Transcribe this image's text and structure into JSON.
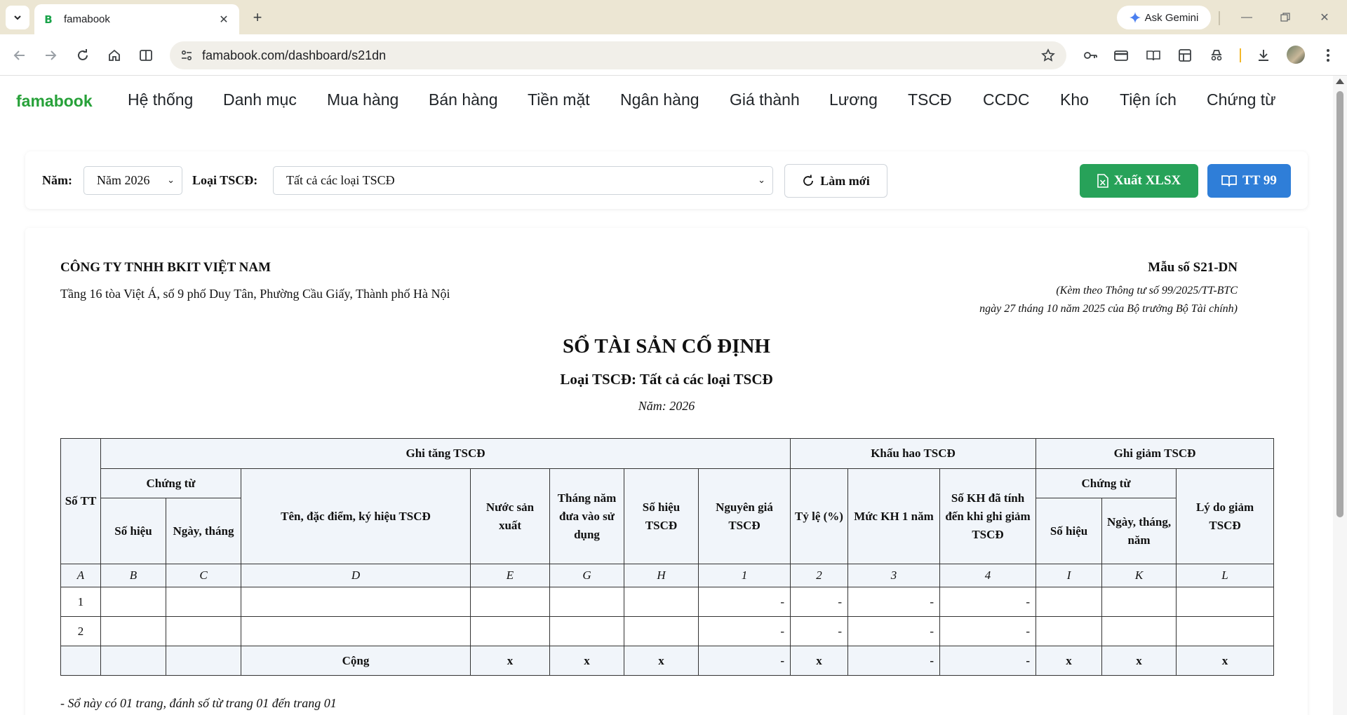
{
  "browser": {
    "tab_title": "famabook",
    "favicon_letter": "B",
    "url": "famabook.com/dashboard/s21dn",
    "gemini_label": "Ask Gemini"
  },
  "nav": {
    "brand": "famabook",
    "items": [
      "Hệ thống",
      "Danh mục",
      "Mua hàng",
      "Bán hàng",
      "Tiền mặt",
      "Ngân hàng",
      "Giá thành",
      "Lương",
      "TSCĐ",
      "CCDC",
      "Kho",
      "Tiện ích",
      "Chứng từ"
    ]
  },
  "filters": {
    "year_label": "Năm:",
    "year_value": "Năm 2026",
    "type_label": "Loại TSCĐ:",
    "type_value": "Tất cả các loại TSCĐ",
    "refresh_label": "Làm mới",
    "export_label": "Xuất XLSX",
    "tt_label": "TT 99"
  },
  "report": {
    "company": "CÔNG TY TNHH BKIT VIỆT NAM",
    "address": "Tầng 16 tòa Việt Á, số 9 phố Duy Tân, Phường Cầu Giấy, Thành phố Hà Nội",
    "form_no": "Mẫu số S21-DN",
    "form_note_1": "(Kèm theo Thông tư số 99/2025/TT-BTC",
    "form_note_2": "ngày 27 tháng 10 năm 2025 của Bộ trưởng Bộ Tài chính)",
    "title": "SỔ TÀI SẢN CỐ ĐỊNH",
    "subtitle": "Loại TSCĐ: Tất cả các loại TSCĐ",
    "year_line": "Năm: 2026",
    "footnote": "- Sổ này có 01 trang, đánh số từ trang 01 đến trang 01"
  },
  "table": {
    "h_stt": "Số TT",
    "h_increase": "Ghi tăng TSCĐ",
    "h_depreciation": "Khấu hao TSCĐ",
    "h_decrease": "Ghi giảm TSCĐ",
    "h_voucher": "Chứng từ",
    "h_voucher2": "Chứng từ",
    "h_so_hieu": "Số hiệu",
    "h_ngay_thang": "Ngày, tháng",
    "h_ten": "Tên, đặc điểm, ký hiệu TSCĐ",
    "h_nuoc": "Nước sản xuất",
    "h_thang_nam": "Tháng năm đưa vào sử dụng",
    "h_so_hieu_tscd": "Số hiệu TSCĐ",
    "h_nguyen_gia": "Nguyên giá TSCĐ",
    "h_ty_le": "Tỷ lệ (%)",
    "h_muc_kh": "Mức KH 1 năm",
    "h_so_kh": "Số KH đã tính đến khi ghi giảm TSCĐ",
    "h_so_hieu2": "Số hiệu",
    "h_ngay_thang_nam": "Ngày, tháng, năm",
    "h_ly_do": "Lý do giảm TSCĐ",
    "codes": [
      "A",
      "B",
      "C",
      "D",
      "E",
      "G",
      "H",
      "1",
      "2",
      "3",
      "4",
      "I",
      "K",
      "L"
    ],
    "rows": [
      {
        "stt": "1",
        "nguyen_gia": "-",
        "ty_le": "-",
        "muc_kh": "-",
        "so_kh": "-"
      },
      {
        "stt": "2",
        "nguyen_gia": "-",
        "ty_le": "-",
        "muc_kh": "-",
        "so_kh": "-"
      }
    ],
    "total": {
      "label": "Cộng",
      "nuoc": "x",
      "thang_nam": "x",
      "so_hieu_tscd": "x",
      "nguyen_gia": "-",
      "ty_le": "x",
      "muc_kh": "-",
      "so_kh": "-",
      "so_hieu2": "x",
      "ngay2": "x",
      "ly_do": "x"
    }
  },
  "colors": {
    "brand_green": "#27a139",
    "export_green": "#27a259",
    "tt_blue": "#2f7ed8",
    "header_bg": "#f1f5fa",
    "chrome_bg": "#ece6d3"
  }
}
